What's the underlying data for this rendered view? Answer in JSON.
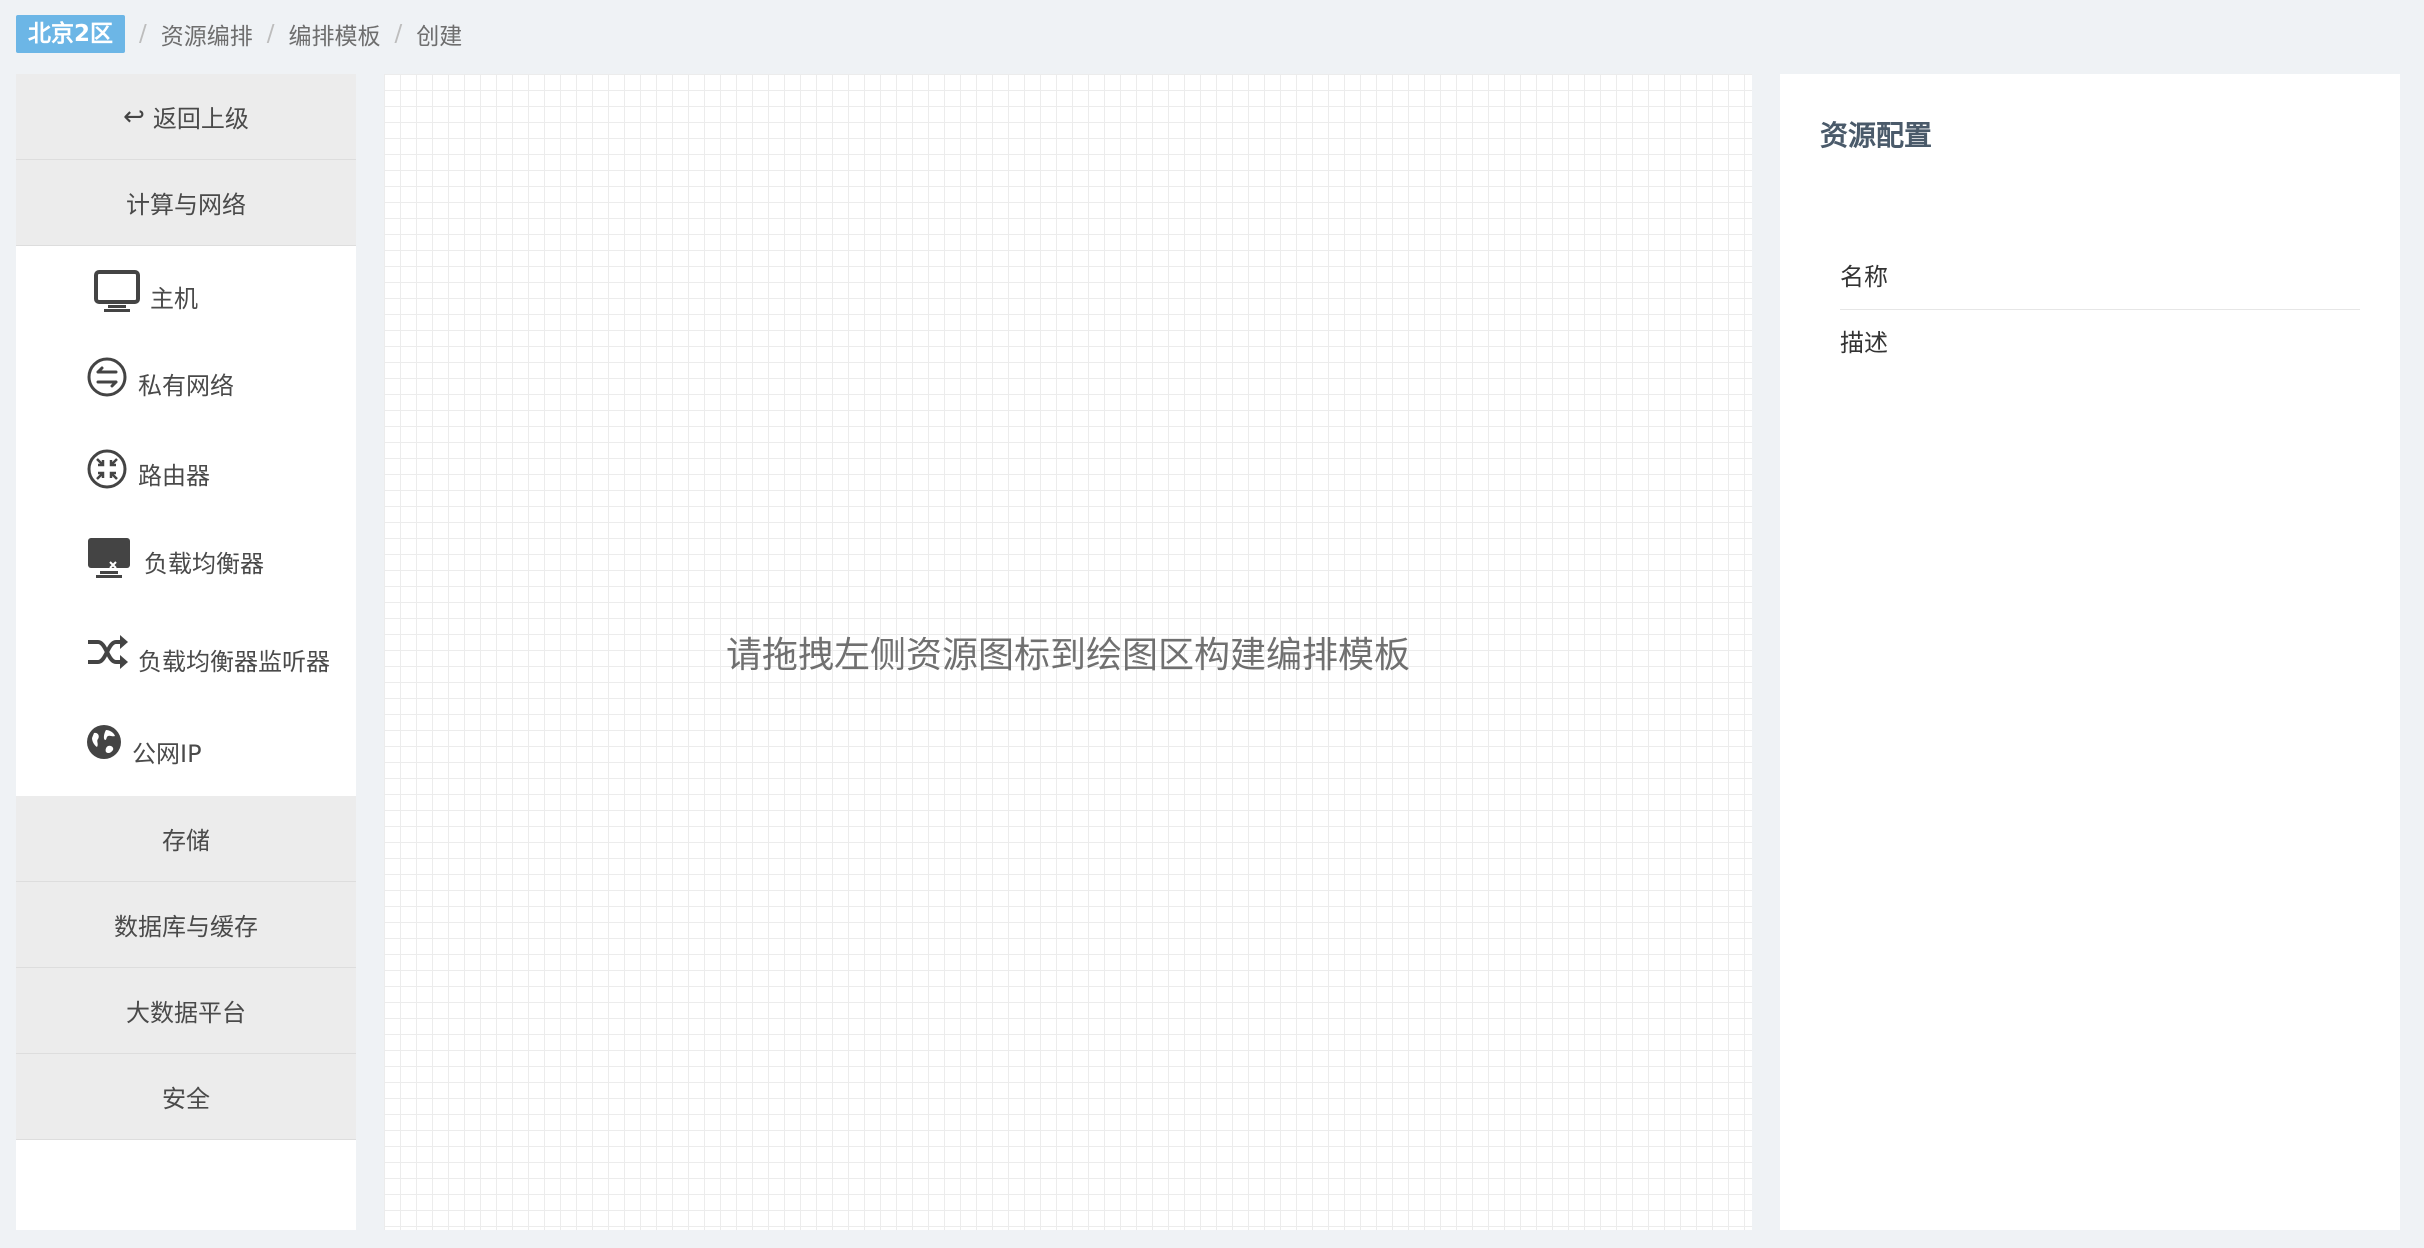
{
  "breadcrumb": {
    "region": "北京2区",
    "items": [
      "资源编排",
      "编排模板",
      "创建"
    ],
    "separator": "/"
  },
  "palette": {
    "back_label": "返回上级",
    "categories_top": [
      "计算与网络"
    ],
    "resources": [
      {
        "label": "主机",
        "icon": "monitor-icon"
      },
      {
        "label": "私有网络",
        "icon": "vpc-icon"
      },
      {
        "label": "路由器",
        "icon": "router-icon"
      },
      {
        "label": "负载均衡器",
        "icon": "load-balancer-icon"
      },
      {
        "label": "负载均衡器监听器",
        "icon": "shuffle-icon"
      },
      {
        "label": "公网IP",
        "icon": "globe-icon"
      }
    ],
    "categories_bottom": [
      "存储",
      "数据库与缓存",
      "大数据平台",
      "安全"
    ]
  },
  "canvas": {
    "hint": "请拖拽左侧资源图标到绘图区构建编排模板"
  },
  "config": {
    "title": "资源配置",
    "fields": [
      "名称",
      "描述"
    ]
  },
  "colors": {
    "region_badge": "#6cb6e6",
    "category_bg": "#ececec",
    "page_bg": "#eff2f5"
  }
}
